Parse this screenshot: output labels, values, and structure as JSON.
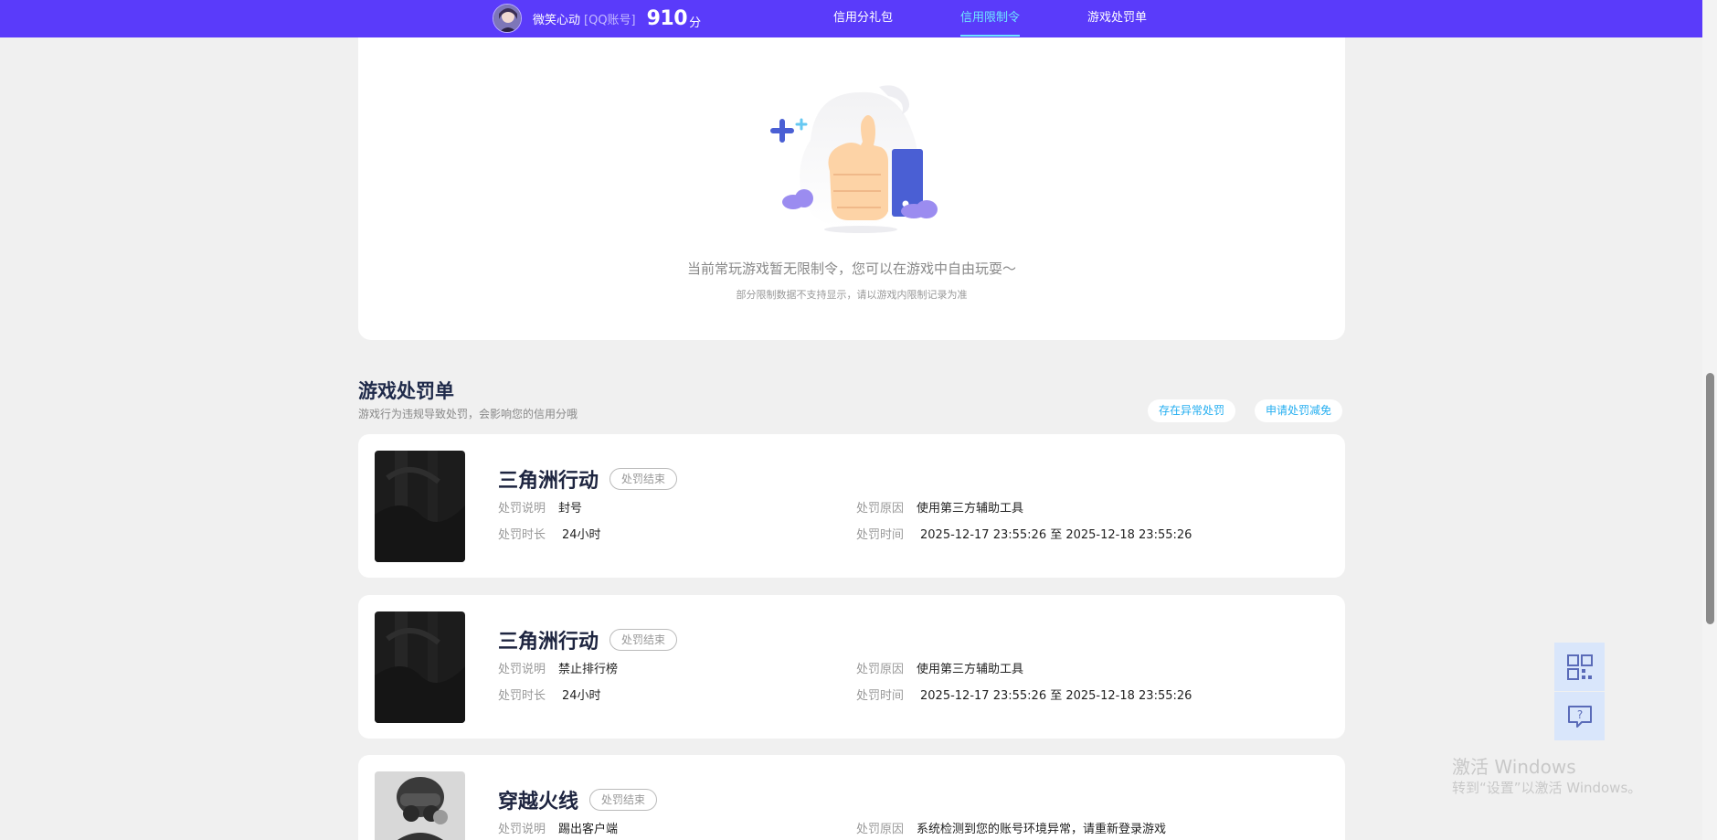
{
  "header": {
    "nickname": "微笑心动",
    "account_type": "[QQ账号]",
    "score": "910",
    "score_unit": "分",
    "nav": [
      {
        "label": "信用分礼包",
        "active": false
      },
      {
        "label": "信用限制令",
        "active": true
      },
      {
        "label": "游戏处罚单",
        "active": false
      }
    ]
  },
  "restriction": {
    "empty_message": "当前常玩游戏暂无限制令，您可以在游戏中自由玩耍～",
    "empty_note": "部分限制数据不支持显示，请以游戏内限制记录为准"
  },
  "penalties": {
    "title": "游戏处罚单",
    "description": "游戏行为违规导致处罚，会影响您的信用分哦",
    "buttons": {
      "abnormal": "存在异常处罚",
      "appeal": "申请处罚减免"
    },
    "labels": {
      "desc": "处罚说明",
      "duration": "处罚时长",
      "reason": "处罚原因",
      "time": "处罚时间"
    },
    "items": [
      {
        "game": "三角洲行动",
        "status": "处罚结束",
        "desc": "封号",
        "duration": "24小时",
        "reason": "使用第三方辅助工具",
        "time": "2025-12-17 23:55:26 至 2025-12-18 23:55:26"
      },
      {
        "game": "三角洲行动",
        "status": "处罚结束",
        "desc": "禁止排行榜",
        "duration": "24小时",
        "reason": "使用第三方辅助工具",
        "time": "2025-12-17 23:55:26 至 2025-12-18 23:55:26"
      },
      {
        "game": "穿越火线",
        "status": "处罚结束",
        "desc": "踢出客户端",
        "duration": "",
        "reason": "系统检测到您的账号环境异常，请重新登录游戏",
        "time": ""
      }
    ]
  },
  "side_buttons": {
    "qr_icon": "qr-code-icon",
    "help_icon": "help-chat-icon"
  },
  "watermark": {
    "line1": "激活 Windows",
    "line2": "转到“设置”以激活 Windows。"
  },
  "colors": {
    "header_bg": "#5a3bfa",
    "active_nav": "#6ee6ff",
    "pill_text": "#24aef0"
  }
}
